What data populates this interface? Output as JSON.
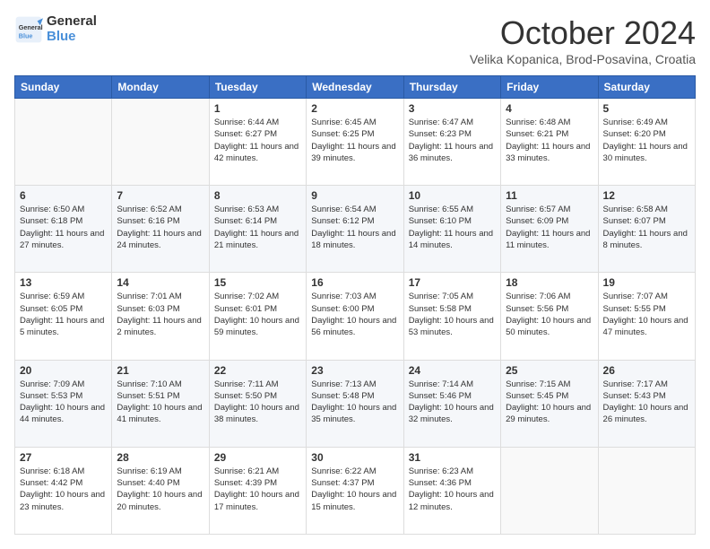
{
  "header": {
    "logo": {
      "line1": "General",
      "line2": "Blue"
    },
    "title": "October 2024",
    "location": "Velika Kopanica, Brod-Posavina, Croatia"
  },
  "days_of_week": [
    "Sunday",
    "Monday",
    "Tuesday",
    "Wednesday",
    "Thursday",
    "Friday",
    "Saturday"
  ],
  "weeks": [
    [
      {
        "day": "",
        "sunrise": "",
        "sunset": "",
        "daylight": ""
      },
      {
        "day": "",
        "sunrise": "",
        "sunset": "",
        "daylight": ""
      },
      {
        "day": "1",
        "sunrise": "Sunrise: 6:44 AM",
        "sunset": "Sunset: 6:27 PM",
        "daylight": "Daylight: 11 hours and 42 minutes."
      },
      {
        "day": "2",
        "sunrise": "Sunrise: 6:45 AM",
        "sunset": "Sunset: 6:25 PM",
        "daylight": "Daylight: 11 hours and 39 minutes."
      },
      {
        "day": "3",
        "sunrise": "Sunrise: 6:47 AM",
        "sunset": "Sunset: 6:23 PM",
        "daylight": "Daylight: 11 hours and 36 minutes."
      },
      {
        "day": "4",
        "sunrise": "Sunrise: 6:48 AM",
        "sunset": "Sunset: 6:21 PM",
        "daylight": "Daylight: 11 hours and 33 minutes."
      },
      {
        "day": "5",
        "sunrise": "Sunrise: 6:49 AM",
        "sunset": "Sunset: 6:20 PM",
        "daylight": "Daylight: 11 hours and 30 minutes."
      }
    ],
    [
      {
        "day": "6",
        "sunrise": "Sunrise: 6:50 AM",
        "sunset": "Sunset: 6:18 PM",
        "daylight": "Daylight: 11 hours and 27 minutes."
      },
      {
        "day": "7",
        "sunrise": "Sunrise: 6:52 AM",
        "sunset": "Sunset: 6:16 PM",
        "daylight": "Daylight: 11 hours and 24 minutes."
      },
      {
        "day": "8",
        "sunrise": "Sunrise: 6:53 AM",
        "sunset": "Sunset: 6:14 PM",
        "daylight": "Daylight: 11 hours and 21 minutes."
      },
      {
        "day": "9",
        "sunrise": "Sunrise: 6:54 AM",
        "sunset": "Sunset: 6:12 PM",
        "daylight": "Daylight: 11 hours and 18 minutes."
      },
      {
        "day": "10",
        "sunrise": "Sunrise: 6:55 AM",
        "sunset": "Sunset: 6:10 PM",
        "daylight": "Daylight: 11 hours and 14 minutes."
      },
      {
        "day": "11",
        "sunrise": "Sunrise: 6:57 AM",
        "sunset": "Sunset: 6:09 PM",
        "daylight": "Daylight: 11 hours and 11 minutes."
      },
      {
        "day": "12",
        "sunrise": "Sunrise: 6:58 AM",
        "sunset": "Sunset: 6:07 PM",
        "daylight": "Daylight: 11 hours and 8 minutes."
      }
    ],
    [
      {
        "day": "13",
        "sunrise": "Sunrise: 6:59 AM",
        "sunset": "Sunset: 6:05 PM",
        "daylight": "Daylight: 11 hours and 5 minutes."
      },
      {
        "day": "14",
        "sunrise": "Sunrise: 7:01 AM",
        "sunset": "Sunset: 6:03 PM",
        "daylight": "Daylight: 11 hours and 2 minutes."
      },
      {
        "day": "15",
        "sunrise": "Sunrise: 7:02 AM",
        "sunset": "Sunset: 6:01 PM",
        "daylight": "Daylight: 10 hours and 59 minutes."
      },
      {
        "day": "16",
        "sunrise": "Sunrise: 7:03 AM",
        "sunset": "Sunset: 6:00 PM",
        "daylight": "Daylight: 10 hours and 56 minutes."
      },
      {
        "day": "17",
        "sunrise": "Sunrise: 7:05 AM",
        "sunset": "Sunset: 5:58 PM",
        "daylight": "Daylight: 10 hours and 53 minutes."
      },
      {
        "day": "18",
        "sunrise": "Sunrise: 7:06 AM",
        "sunset": "Sunset: 5:56 PM",
        "daylight": "Daylight: 10 hours and 50 minutes."
      },
      {
        "day": "19",
        "sunrise": "Sunrise: 7:07 AM",
        "sunset": "Sunset: 5:55 PM",
        "daylight": "Daylight: 10 hours and 47 minutes."
      }
    ],
    [
      {
        "day": "20",
        "sunrise": "Sunrise: 7:09 AM",
        "sunset": "Sunset: 5:53 PM",
        "daylight": "Daylight: 10 hours and 44 minutes."
      },
      {
        "day": "21",
        "sunrise": "Sunrise: 7:10 AM",
        "sunset": "Sunset: 5:51 PM",
        "daylight": "Daylight: 10 hours and 41 minutes."
      },
      {
        "day": "22",
        "sunrise": "Sunrise: 7:11 AM",
        "sunset": "Sunset: 5:50 PM",
        "daylight": "Daylight: 10 hours and 38 minutes."
      },
      {
        "day": "23",
        "sunrise": "Sunrise: 7:13 AM",
        "sunset": "Sunset: 5:48 PM",
        "daylight": "Daylight: 10 hours and 35 minutes."
      },
      {
        "day": "24",
        "sunrise": "Sunrise: 7:14 AM",
        "sunset": "Sunset: 5:46 PM",
        "daylight": "Daylight: 10 hours and 32 minutes."
      },
      {
        "day": "25",
        "sunrise": "Sunrise: 7:15 AM",
        "sunset": "Sunset: 5:45 PM",
        "daylight": "Daylight: 10 hours and 29 minutes."
      },
      {
        "day": "26",
        "sunrise": "Sunrise: 7:17 AM",
        "sunset": "Sunset: 5:43 PM",
        "daylight": "Daylight: 10 hours and 26 minutes."
      }
    ],
    [
      {
        "day": "27",
        "sunrise": "Sunrise: 6:18 AM",
        "sunset": "Sunset: 4:42 PM",
        "daylight": "Daylight: 10 hours and 23 minutes."
      },
      {
        "day": "28",
        "sunrise": "Sunrise: 6:19 AM",
        "sunset": "Sunset: 4:40 PM",
        "daylight": "Daylight: 10 hours and 20 minutes."
      },
      {
        "day": "29",
        "sunrise": "Sunrise: 6:21 AM",
        "sunset": "Sunset: 4:39 PM",
        "daylight": "Daylight: 10 hours and 17 minutes."
      },
      {
        "day": "30",
        "sunrise": "Sunrise: 6:22 AM",
        "sunset": "Sunset: 4:37 PM",
        "daylight": "Daylight: 10 hours and 15 minutes."
      },
      {
        "day": "31",
        "sunrise": "Sunrise: 6:23 AM",
        "sunset": "Sunset: 4:36 PM",
        "daylight": "Daylight: 10 hours and 12 minutes."
      },
      {
        "day": "",
        "sunrise": "",
        "sunset": "",
        "daylight": ""
      },
      {
        "day": "",
        "sunrise": "",
        "sunset": "",
        "daylight": ""
      }
    ]
  ]
}
